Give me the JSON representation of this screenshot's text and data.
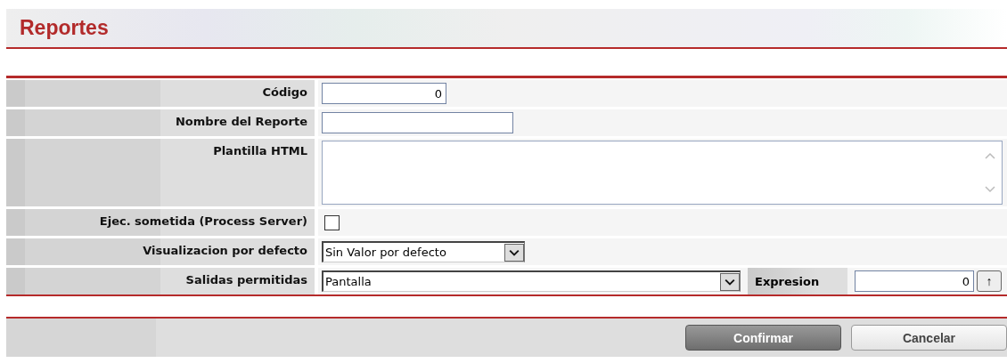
{
  "header": {
    "title": "Reportes"
  },
  "form": {
    "rows": [
      {
        "kind": "text",
        "label": "Código",
        "value": "0"
      },
      {
        "kind": "text",
        "label": "Nombre del Reporte",
        "value": ""
      },
      {
        "kind": "textarea",
        "label": "Plantilla HTML"
      },
      {
        "kind": "checkbox",
        "label": "Ejec. sometida (Process Server)",
        "checked": false
      },
      {
        "kind": "select",
        "label": "Visualizacion por defecto",
        "value": "Sin Valor por defecto"
      },
      {
        "kind": "select",
        "label": "Salidas permitidas",
        "value": "Pantalla",
        "extra": {
          "label": "Expresion",
          "value": "0",
          "button": "↑"
        }
      }
    ]
  },
  "buttons": [
    {
      "label": "Confirmar",
      "primary": true
    },
    {
      "label": "Cancelar",
      "primary": false
    }
  ]
}
